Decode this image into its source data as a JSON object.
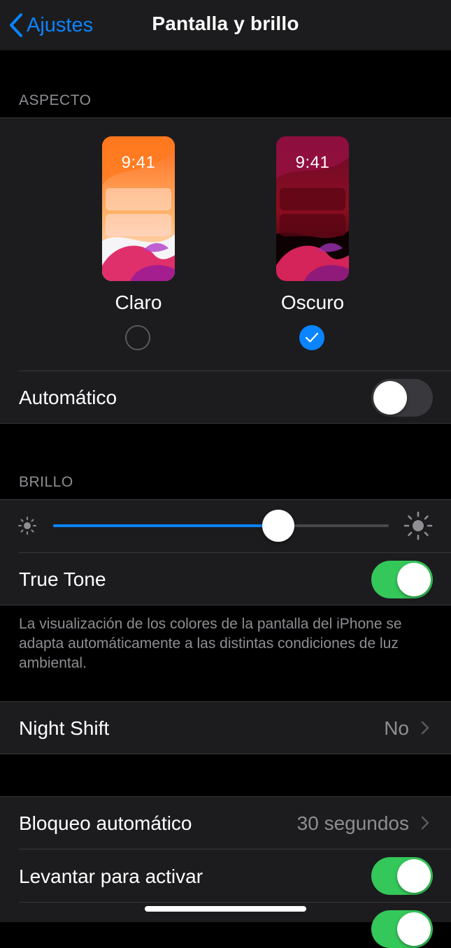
{
  "navbar": {
    "back_label": "Ajustes",
    "title": "Pantalla y brillo"
  },
  "appearance": {
    "header": "ASPECTO",
    "options": [
      {
        "label": "Claro",
        "time": "9:41",
        "selected": false
      },
      {
        "label": "Oscuro",
        "time": "9:41",
        "selected": true
      }
    ],
    "automatic_label": "Automático",
    "automatic_on": false
  },
  "brightness": {
    "header": "BRILLO",
    "level": 0.67,
    "true_tone_label": "True Tone",
    "true_tone_on": true,
    "true_tone_footer": "La visualización de los colores de la pantalla del iPhone se adapta automáticamente a las distintas condiciones de luz ambiental."
  },
  "night_shift": {
    "label": "Night Shift",
    "value": "No"
  },
  "lock": {
    "auto_lock_label": "Bloqueo automático",
    "auto_lock_value": "30 segundos",
    "raise_to_wake_label": "Levantar para activar",
    "raise_to_wake_on": true
  },
  "colors": {
    "accent": "#0a84ff",
    "toggle_on": "#34c759",
    "group_bg": "#1c1c1e",
    "secondary_text": "#8e8e93"
  }
}
